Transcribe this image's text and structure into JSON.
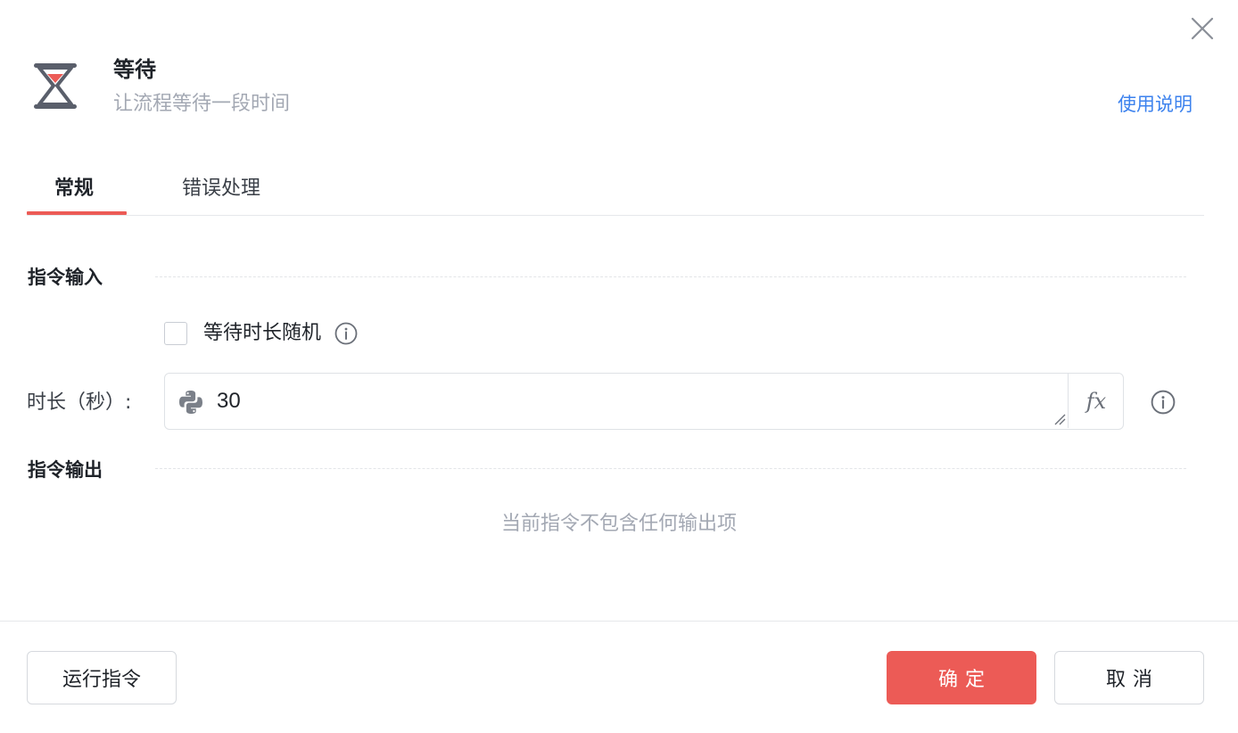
{
  "header": {
    "title": "等待",
    "subtitle": "让流程等待一段时间",
    "help_link": "使用说明",
    "icon": "hourglass-icon"
  },
  "tabs": [
    {
      "label": "常规",
      "active": true
    },
    {
      "label": "错误处理",
      "active": false
    }
  ],
  "input_section": {
    "title": "指令输入",
    "random_checkbox": {
      "label": "等待时长随机",
      "checked": false
    },
    "duration": {
      "label": "时长（秒）:",
      "value": "30",
      "fx_label": "fx"
    }
  },
  "output_section": {
    "title": "指令输出",
    "empty_text": "当前指令不包含任何输出项"
  },
  "footer": {
    "run_label": "运行指令",
    "ok_label": "确定",
    "cancel_label": "取消"
  },
  "colors": {
    "accent": "#ec5b56",
    "link": "#3c82ee",
    "muted": "#a3a8b3"
  }
}
